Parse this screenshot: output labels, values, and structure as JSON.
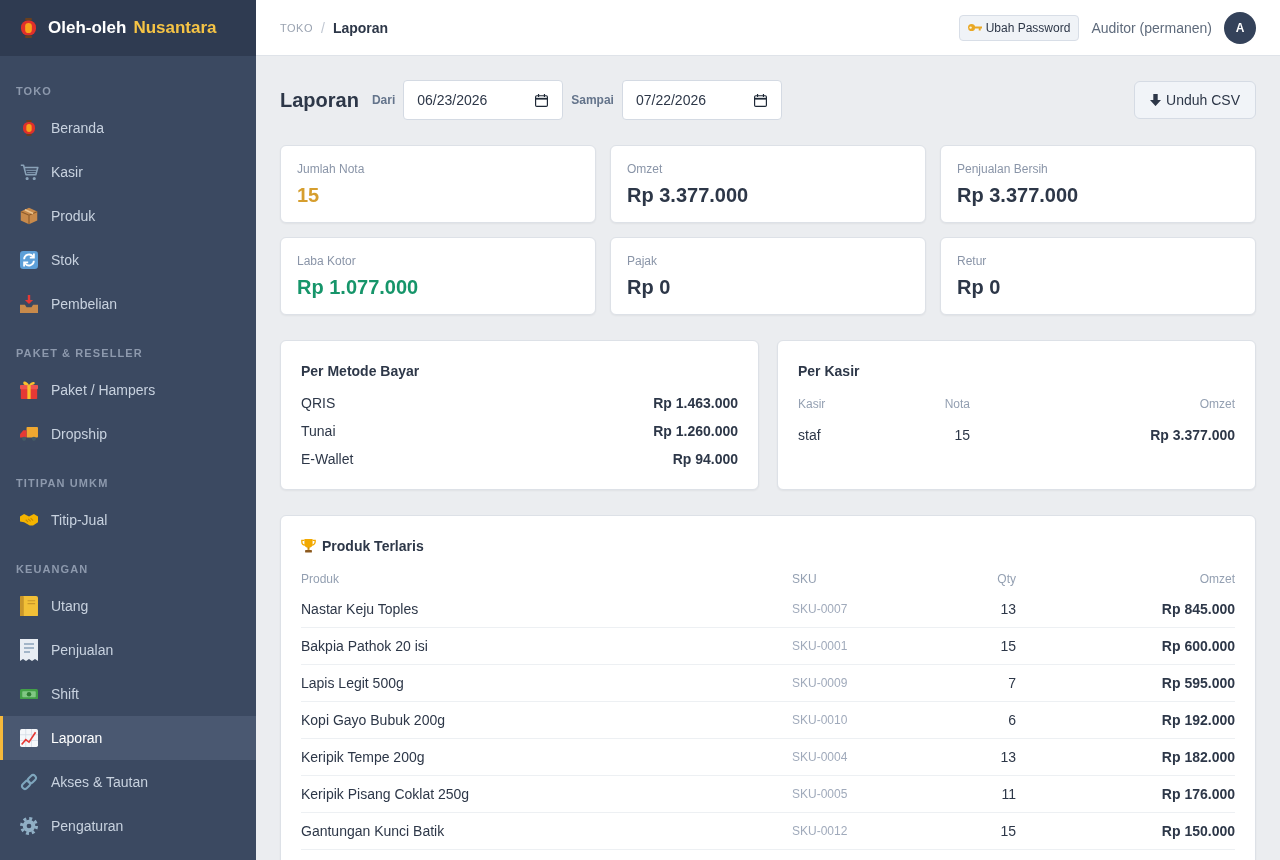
{
  "sidebar": {
    "brand": {
      "name": "Oleh-oleh",
      "highlight": "Nusantara"
    },
    "sections": [
      {
        "heading": "TOKO",
        "items": [
          {
            "label": "Beranda",
            "selected": false
          },
          {
            "label": "Kasir",
            "selected": false
          },
          {
            "label": "Produk",
            "selected": false
          },
          {
            "label": "Stok",
            "selected": false
          },
          {
            "label": "Pembelian",
            "selected": false
          }
        ]
      },
      {
        "heading": "PAKET & RESELLER",
        "items": [
          {
            "label": "Paket / Hampers",
            "selected": false
          },
          {
            "label": "Dropship",
            "selected": false
          }
        ]
      },
      {
        "heading": "TITIPAN UMKM",
        "items": [
          {
            "label": "Titip-Jual",
            "selected": false
          }
        ]
      },
      {
        "heading": "KEUANGAN",
        "items": [
          {
            "label": "Utang",
            "selected": false
          },
          {
            "label": "Penjualan",
            "selected": false
          },
          {
            "label": "Shift",
            "selected": false
          },
          {
            "label": "Laporan",
            "selected": true
          },
          {
            "label": "Akses & Tautan",
            "selected": false
          },
          {
            "label": "Pengaturan",
            "selected": false
          }
        ]
      }
    ]
  },
  "header": {
    "breadcrumb": {
      "parent": "TOKO",
      "separator": "/",
      "current": "Laporan"
    },
    "password_button": "Ubah Password",
    "user": "Auditor (permanen)",
    "avatar": "A"
  },
  "toolbar": {
    "title": "Laporan",
    "from_label": "Dari",
    "from_value": "06/23/2026",
    "to_label": "Sampai",
    "to_value": "07/22/2026",
    "export_button": "Unduh CSV"
  },
  "stats": [
    {
      "label": "Jumlah Nota",
      "value": "15",
      "color": "#d69e2e"
    },
    {
      "label": "Omzet",
      "value": "Rp 3.377.000",
      "color": "#2d3748"
    },
    {
      "label": "Penjualan Bersih",
      "value": "Rp 3.377.000",
      "color": "#2d3748"
    },
    {
      "label": "Laba Kotor",
      "value": "Rp 1.077.000",
      "color": "#16956a"
    },
    {
      "label": "Pajak",
      "value": "Rp 0",
      "color": "#2d3748"
    },
    {
      "label": "Retur",
      "value": "Rp 0",
      "color": "#2d3748"
    }
  ],
  "payment_methods": {
    "title": "Per Metode Bayar",
    "rows": [
      {
        "method": "QRIS",
        "amount": "Rp 1.463.000"
      },
      {
        "method": "Tunai",
        "amount": "Rp 1.260.000"
      },
      {
        "method": "E-Wallet",
        "amount": "Rp 94.000"
      }
    ]
  },
  "cashiers": {
    "title": "Per Kasir",
    "columns": [
      "Kasir",
      "Nota",
      "Omzet"
    ],
    "rows": [
      {
        "cashier": "staf",
        "receipts": "15",
        "revenue": "Rp 3.377.000"
      }
    ]
  },
  "top_products": {
    "title": "Produk Terlaris",
    "columns": [
      "Produk",
      "SKU",
      "Qty",
      "Omzet"
    ],
    "rows": [
      {
        "product": "Nastar Keju Toples",
        "sku": "SKU-0007",
        "qty": "13",
        "revenue": "Rp 845.000"
      },
      {
        "product": "Bakpia Pathok 20 isi",
        "sku": "SKU-0001",
        "qty": "15",
        "revenue": "Rp 600.000"
      },
      {
        "product": "Lapis Legit 500g",
        "sku": "SKU-0009",
        "qty": "7",
        "revenue": "Rp 595.000"
      },
      {
        "product": "Kopi Gayo Bubuk 200g",
        "sku": "SKU-0010",
        "qty": "6",
        "revenue": "Rp 192.000"
      },
      {
        "product": "Keripik Tempe 200g",
        "sku": "SKU-0004",
        "qty": "13",
        "revenue": "Rp 182.000"
      },
      {
        "product": "Keripik Pisang Coklat 250g",
        "sku": "SKU-0005",
        "qty": "11",
        "revenue": "Rp 176.000"
      },
      {
        "product": "Gantungan Kunci Batik",
        "sku": "SKU-0012",
        "qty": "15",
        "revenue": "Rp 150.000"
      }
    ]
  }
}
